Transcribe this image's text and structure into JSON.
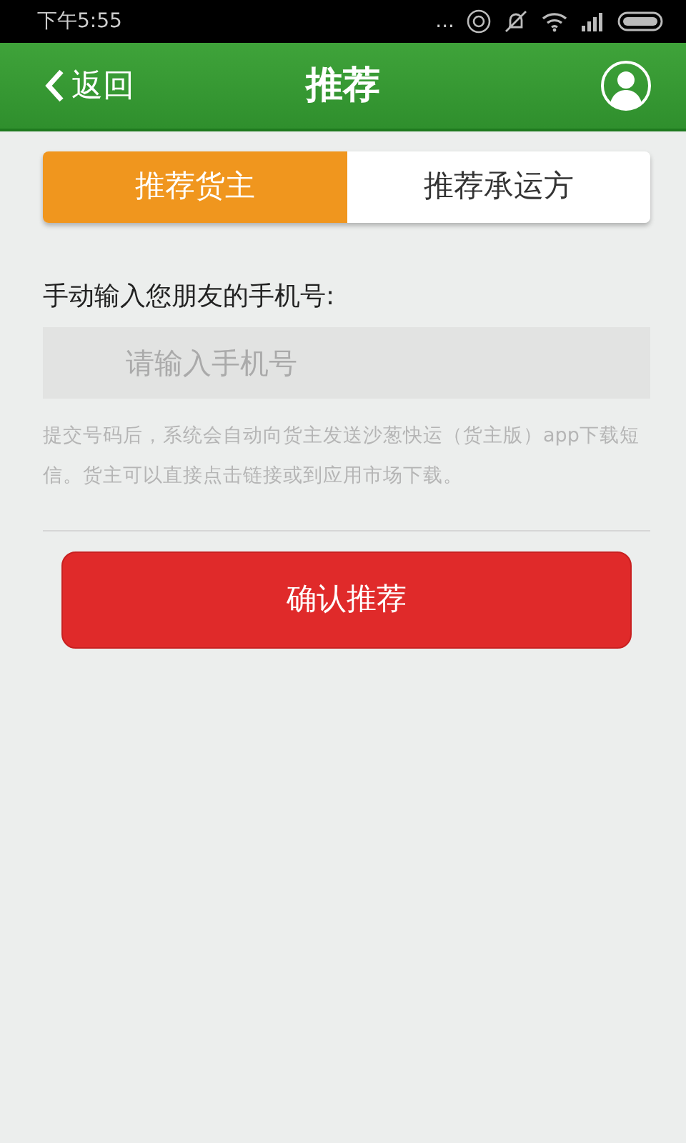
{
  "status_bar": {
    "time": "下午5:55",
    "dots": "..."
  },
  "header": {
    "back": "返回",
    "title": "推荐"
  },
  "tabs": [
    {
      "label": "推荐货主",
      "selected": true
    },
    {
      "label": "推荐承运方",
      "selected": false
    }
  ],
  "form": {
    "label": "手动输入您朋友的手机号:",
    "placeholder": "请输入手机号",
    "hint": "提交号码后，系统会自动向货主发送沙葱快运（货主版）app下载短信。货主可以直接点击链接或到应用市场下载。"
  },
  "submit": "确认推荐"
}
